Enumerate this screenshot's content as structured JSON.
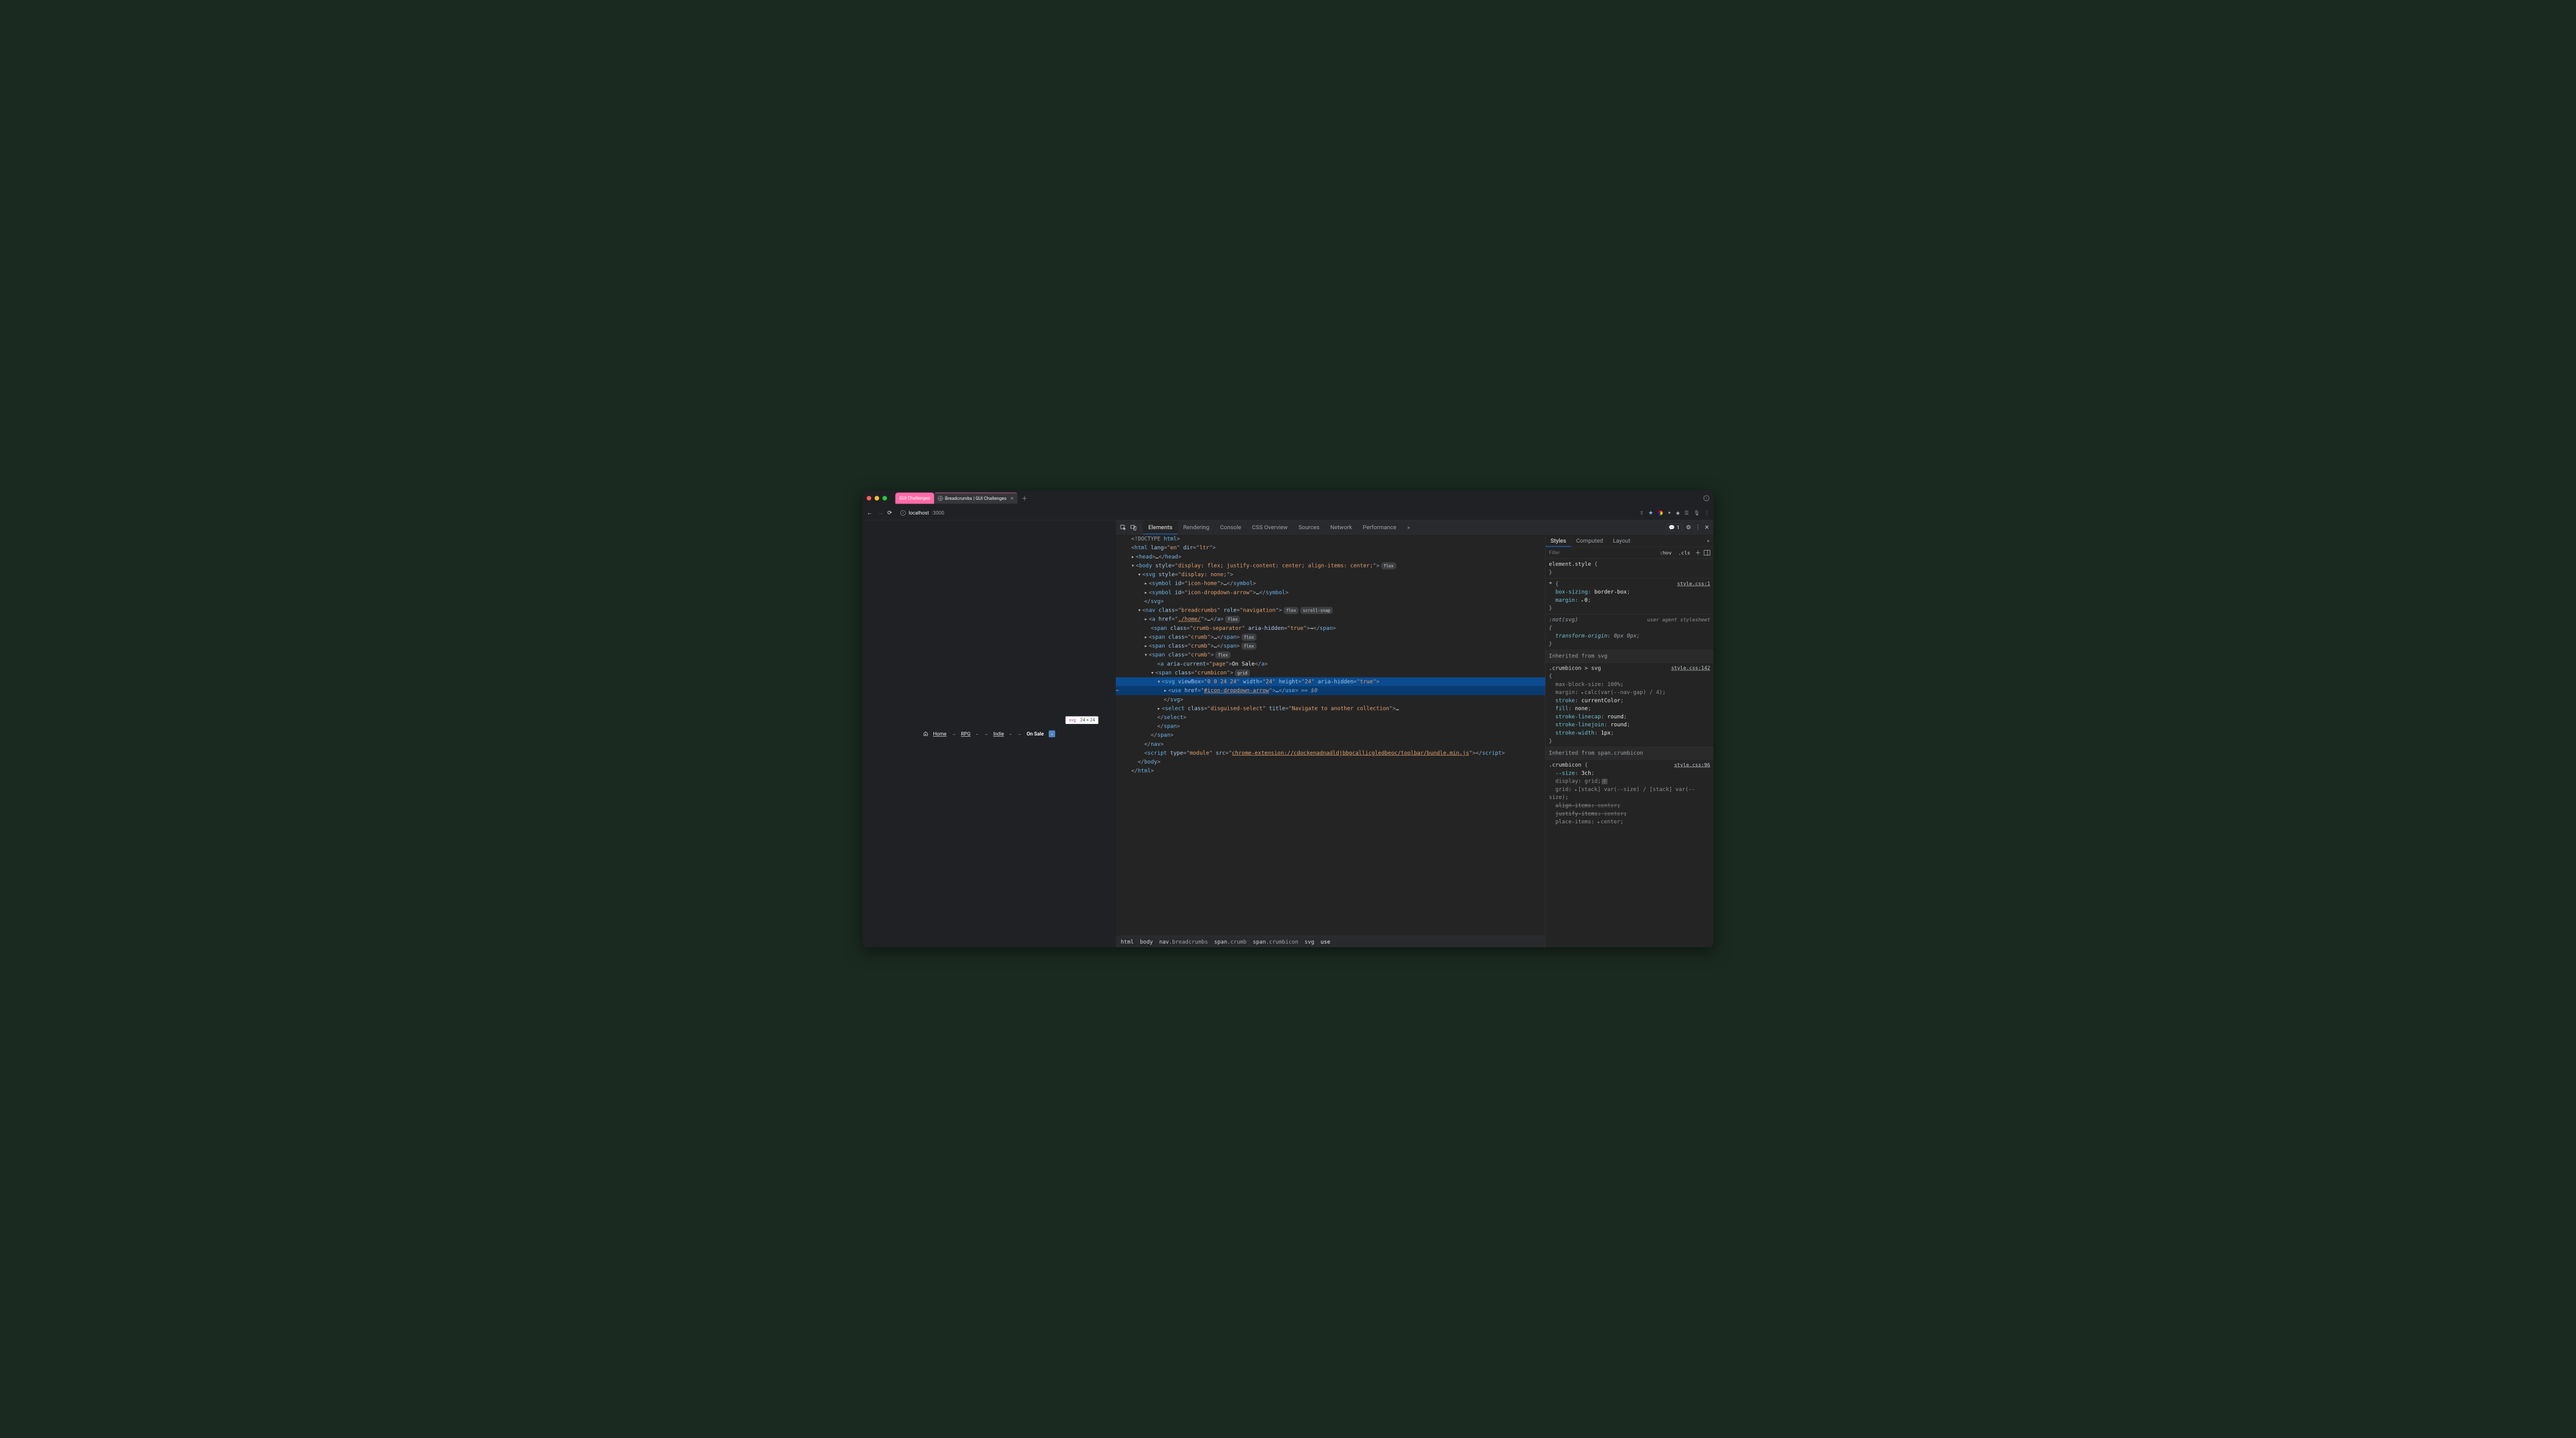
{
  "browser": {
    "tabs": [
      {
        "label": "GUI Challenges",
        "kind": "pink"
      },
      {
        "label": "Breadcrumbs | GUI Challenges",
        "kind": "active"
      }
    ],
    "url_host": "localhost",
    "url_port": ":3000",
    "page": {
      "tooltip_tag": "svg",
      "tooltip_dim": "24 × 24",
      "crumbs": {
        "home": "Home",
        "rpg": "RPG",
        "indie": "Indie",
        "onsale": "On Sale"
      }
    }
  },
  "devtools": {
    "tabs": [
      "Elements",
      "Rendering",
      "Console",
      "CSS Overview",
      "Sources",
      "Network",
      "Performance"
    ],
    "active_tab": "Elements",
    "error_count": "1",
    "styles": {
      "tabs": [
        "Styles",
        "Computed",
        "Layout"
      ],
      "active": "Styles",
      "filter_placeholder": "Filter",
      "hov": ":hov",
      "cls": ".cls"
    },
    "breadcrumb_path": [
      {
        "el": "html",
        "cls": ""
      },
      {
        "el": "body",
        "cls": ""
      },
      {
        "el": "nav",
        "cls": ".breadcrumbs"
      },
      {
        "el": "span",
        "cls": ".crumb"
      },
      {
        "el": "span",
        "cls": ".crumbicon"
      },
      {
        "el": "svg",
        "cls": ""
      },
      {
        "el": "use",
        "cls": ""
      }
    ],
    "dom": {
      "doctype": "<!DOCTYPE html>",
      "html_attrs": {
        "lang": "en",
        "dir": "ltr"
      },
      "body_style": "display: flex; justify-content: center; align-items: center;",
      "svg_style": "display: none;",
      "symbol1_id": "icon-home",
      "symbol2_id": "icon-dropdown-arrow",
      "nav_class": "breadcrumbs",
      "nav_role": "navigation",
      "a_href": "./home/",
      "sep_class": "crumb-separator",
      "sep_aria": "true",
      "crumb_class": "crumb",
      "aria_current": "page",
      "onsale_text": "On Sale",
      "crumbicon_class": "crumbicon",
      "svg_viewbox": "0 0 24 24",
      "svg_w": "24",
      "svg_h": "24",
      "svg_aria": "true",
      "use_href": "#icon-dropdown-arrow",
      "select_class": "disguised-select",
      "select_title": "Navigate to another collection",
      "script_type": "module",
      "script_src": "chrome-extension://cdockenadnadldjbbgcallicgledbeoc/toolbar/bundle.min.js"
    },
    "rules": {
      "r0": {
        "selector": "element.style"
      },
      "r1": {
        "selector": "*",
        "src": "style.css:1",
        "box_sizing": "box-sizing",
        "box_sizing_v": "border-box",
        "margin": "margin",
        "margin_v": "0"
      },
      "r2": {
        "selector": ":not(svg)",
        "ua": "user agent stylesheet",
        "transform_origin": "transform-origin",
        "transform_origin_v": "0px 0px"
      },
      "inh1": "Inherited from",
      "inh1_el": "svg",
      "r3": {
        "selector": ".crumbicon > svg",
        "src": "style.css:142",
        "p1": "max-block-size",
        "v1": "100%",
        "p2": "margin",
        "v2": "calc(var(--nav-gap) / 4)",
        "p3": "stroke",
        "v3": "currentColor",
        "p4": "fill",
        "v4": "none",
        "p5": "stroke-linecap",
        "v5": "round",
        "p6": "stroke-linejoin",
        "v6": "round",
        "p7": "stroke-width",
        "v7": "1px"
      },
      "inh2": "Inherited from",
      "inh2_el": "span.crumbicon",
      "r4": {
        "selector": ".crumbicon",
        "src": "style.css:96",
        "p1": "--size",
        "v1": "3ch",
        "p2": "display",
        "v2": "grid",
        "p3": "grid",
        "v3": "[stack] var(--size) / [stack] var(--size)",
        "p4": "align-items",
        "v4": "center",
        "p5": "justify-items",
        "v5": "center",
        "p6": "place-items",
        "v6": "center"
      }
    }
  }
}
